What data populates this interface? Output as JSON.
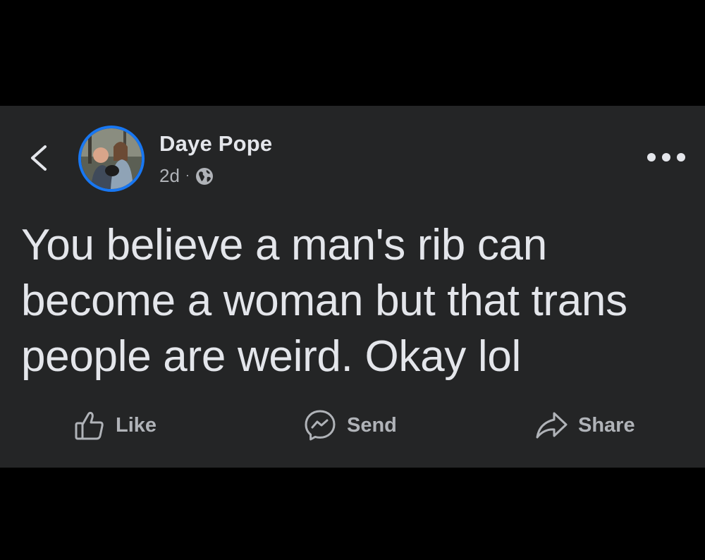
{
  "post": {
    "author": "Daye Pope",
    "timestamp": "2d",
    "separator": "·",
    "audience_icon": "globe-icon",
    "text": "You believe a man's rib can become a woman but that trans people are weird. Okay lol",
    "accent_color": "#1877f2",
    "background_color": "#242526"
  },
  "actions": {
    "like_label": "Like",
    "send_label": "Send",
    "share_label": "Share"
  },
  "icons": {
    "back": "chevron-left-icon",
    "more": "more-horizontal-icon",
    "like": "thumbs-up-icon",
    "send": "messenger-icon",
    "share": "share-arrow-icon"
  }
}
